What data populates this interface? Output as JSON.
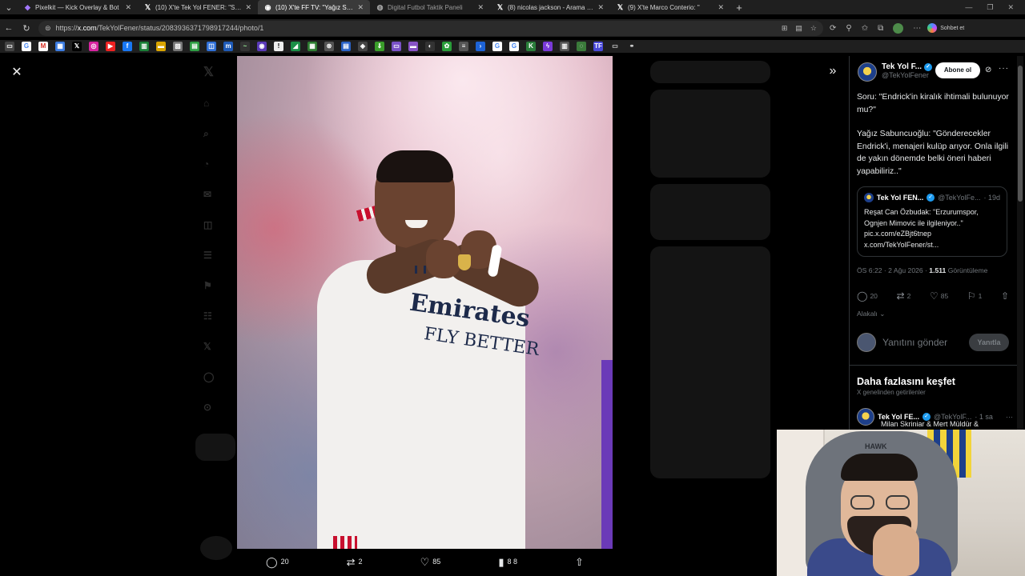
{
  "browser": {
    "tabs": [
      {
        "title": "Pixelkit — Kick Overlay & Bot",
        "icon": "pixelkit-icon",
        "active": false
      },
      {
        "title": "(10) X'te Tek Yol FENER: \"Soru: \"En",
        "icon": "x-icon",
        "active": false
      },
      {
        "title": "(10) X'te FF TV: \"Yağız Sab",
        "icon": "x-icon",
        "active": true
      },
      {
        "title": "Digital Futbol Taktik Paneli",
        "icon": "globe-icon",
        "active": false
      },
      {
        "title": "(8) nicolas jackson - Arama / X",
        "icon": "x-icon",
        "active": false
      },
      {
        "title": "(9) X'te Marco Conterio: \"",
        "icon": "x-icon",
        "active": false
      }
    ],
    "url_prefix": "https://",
    "url_host": "x.com",
    "url_path": "/TekYolFener/status/2083936371798917244/photo/1",
    "copilot_label": "Sohbet et"
  },
  "photo_actions": {
    "replies": "20",
    "reposts": "2",
    "likes": "85",
    "views": "8 8"
  },
  "tweet": {
    "author_name": "Tek Yol F...",
    "author_handle": "@TekYolFener",
    "follow_label": "Abone ol",
    "paragraphs": [
      "Soru: \"Endrick'in kiralık ihtimali bulunuyor mu?\"",
      "Yağız Sabuncuoğlu: \"Gönderecekler Endrick'i, menajeri kulüp arıyor. Onla ilgili de yakın dönemde belki öneri haberi yapabiliriz..\""
    ],
    "quote": {
      "name": "Tek Yol FEN...",
      "handle": "@TekYolFe...",
      "age": "· 19d",
      "text": "Reşat Can Özbudak: \"Erzurumspor, Ognjen Mimovic ile ilgileniyor..\" pic.x.com/eZBjt6tnep x.com/TekYolFener/st..."
    },
    "timestamp": "ÖS 6:22 · 2 Ağu 2026 · ",
    "views_count": "1.511",
    "views_label": " Görüntüleme",
    "counts": {
      "replies": "20",
      "reposts": "2",
      "likes": "85",
      "bookmarks": "1"
    },
    "relevant_label": "Alakalı",
    "reply_placeholder": "Yanıtını gönder",
    "reply_button": "Yanıtla"
  },
  "discover": {
    "title": "Daha fazlasını keşfet",
    "subtitle": "X genelinden getirilenler",
    "item": {
      "name": "Tek Yol FE...",
      "handle": "@TekYolF...",
      "age": "· 1 sa",
      "text": "Milan Skriniar & Mert Müldür &"
    }
  },
  "colors": {
    "accent": "#1d9bf0",
    "background": "#000000",
    "muted_text": "#71767b"
  }
}
